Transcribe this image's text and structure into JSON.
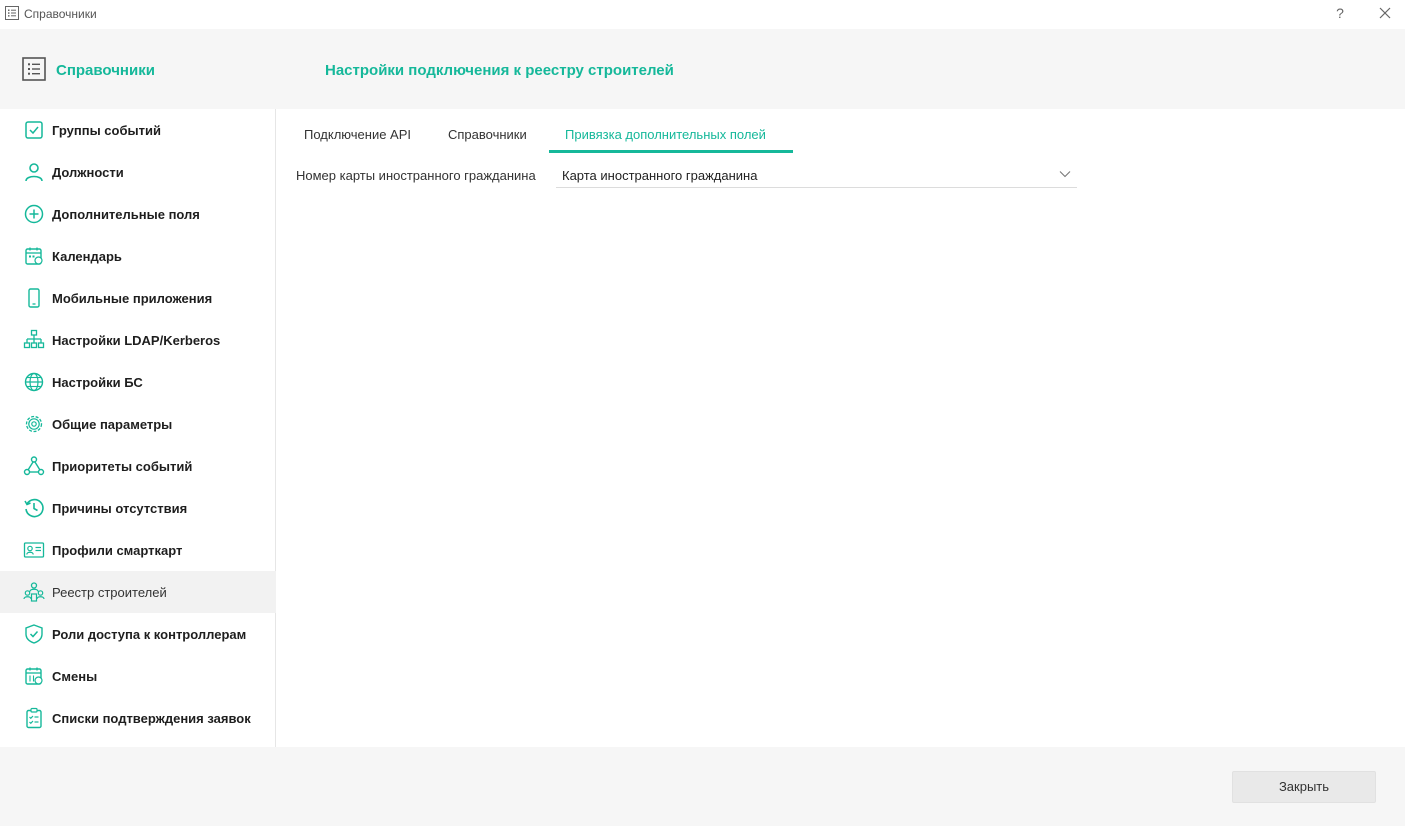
{
  "window": {
    "title": "Справочники",
    "help_label": "?",
    "icon": "list-icon",
    "close_icon": "close-icon"
  },
  "header": {
    "app_name": "Справочники",
    "page_title": "Настройки подключения к реестру строителей",
    "icon": "list-icon"
  },
  "sidebar": {
    "items": [
      {
        "label": "Группы событий",
        "icon": "checkbox-icon",
        "active": false
      },
      {
        "label": "Должности",
        "icon": "person-icon",
        "active": false
      },
      {
        "label": "Дополнительные поля",
        "icon": "plus-circle-icon",
        "active": false
      },
      {
        "label": "Календарь",
        "icon": "calendar-icon",
        "active": false
      },
      {
        "label": "Мобильные приложения",
        "icon": "phone-icon",
        "active": false
      },
      {
        "label": "Настройки LDAP/Kerberos",
        "icon": "network-icon",
        "active": false
      },
      {
        "label": "Настройки БС",
        "icon": "globe-icon",
        "active": false
      },
      {
        "label": "Общие параметры",
        "icon": "gear-icon",
        "active": false
      },
      {
        "label": "Приоритеты событий",
        "icon": "nodes-icon",
        "active": false
      },
      {
        "label": "Причины отсутствия",
        "icon": "history-icon",
        "active": false
      },
      {
        "label": "Профили смарткарт",
        "icon": "id-card-icon",
        "active": false
      },
      {
        "label": "Реестр строителей",
        "icon": "builders-icon",
        "active": true
      },
      {
        "label": "Роли доступа к контроллерам",
        "icon": "shield-check-icon",
        "active": false
      },
      {
        "label": "Смены",
        "icon": "calendar-clock-icon",
        "active": false
      },
      {
        "label": "Списки подтверждения заявок",
        "icon": "clipboard-check-icon",
        "active": false
      }
    ]
  },
  "tabs": [
    {
      "label": "Подключение API",
      "active": false
    },
    {
      "label": "Справочники",
      "active": false
    },
    {
      "label": "Привязка дополнительных полей",
      "active": true
    }
  ],
  "form": {
    "field_label": "Номер карты иностранного гражданина",
    "field_value": "Карта иностранного гражданина"
  },
  "footer": {
    "close_label": "Закрыть"
  },
  "colors": {
    "accent": "#15b89a",
    "header_bg": "#f6f6f6",
    "active_item_bg": "#f2f2f2"
  }
}
